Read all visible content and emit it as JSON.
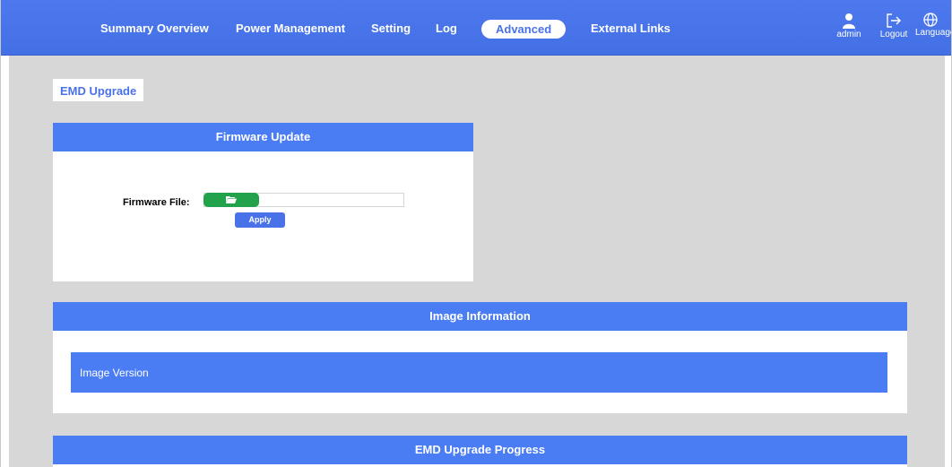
{
  "nav": {
    "items": [
      "Summary Overview",
      "Power Management",
      "Setting",
      "Log",
      "Advanced",
      "External Links"
    ],
    "active": "Advanced",
    "user_label": "admin",
    "logout_label": "Logout",
    "language_label": "Language"
  },
  "breadcrumb": "EMD Upgrade",
  "firmware": {
    "title": "Firmware Update",
    "file_label": "Firmware File:",
    "apply_label": "Apply"
  },
  "image_info": {
    "title": "Image Information",
    "version_label": "Image Version"
  },
  "progress": {
    "title": "EMD Upgrade Progress"
  },
  "colors": {
    "primary": "#4a7cf3",
    "background": "#d7d7d7",
    "file_button": "#22a24a"
  }
}
